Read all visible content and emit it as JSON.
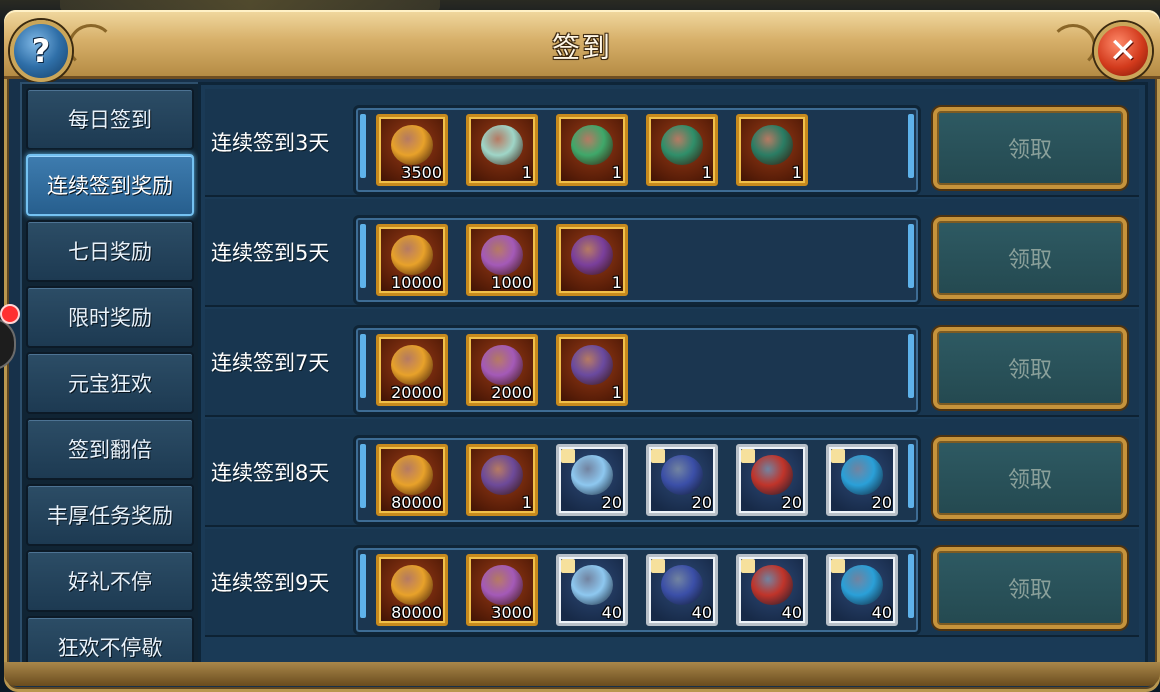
{
  "window": {
    "title": "签到",
    "help_label": "?",
    "close_label": "✕"
  },
  "sidebar": {
    "items": [
      {
        "label": "每日签到",
        "active": false
      },
      {
        "label": "连续签到奖励",
        "active": true
      },
      {
        "label": "七日奖励",
        "active": false
      },
      {
        "label": "限时奖励",
        "active": false
      },
      {
        "label": "元宝狂欢",
        "active": false
      },
      {
        "label": "签到翻倍",
        "active": false
      },
      {
        "label": "丰厚任务奖励",
        "active": false
      },
      {
        "label": "好礼不停",
        "active": false
      },
      {
        "label": "狂欢不停歇",
        "active": false
      }
    ]
  },
  "rows": [
    {
      "label": "连续签到3天",
      "claim_label": "领取",
      "items": [
        {
          "icon": "gold-ingot-icon",
          "qty": "3500",
          "frame": "gold",
          "color": "#e8a22a"
        },
        {
          "icon": "jade-pendant-icon",
          "qty": "1",
          "frame": "gold",
          "color": "#9fd6c8"
        },
        {
          "icon": "jade-bracelet-icon",
          "qty": "1",
          "frame": "gold",
          "color": "#3fa86a"
        },
        {
          "icon": "jade-armor-icon",
          "qty": "1",
          "frame": "gold",
          "color": "#2f8f6a"
        },
        {
          "icon": "jade-helmet-icon",
          "qty": "1",
          "frame": "gold",
          "color": "#2a7d64"
        }
      ]
    },
    {
      "label": "连续签到5天",
      "claim_label": "领取",
      "items": [
        {
          "icon": "gold-ingot-icon",
          "qty": "10000",
          "frame": "gold",
          "color": "#e8a22a"
        },
        {
          "icon": "purple-flower-icon",
          "qty": "1000",
          "frame": "gold",
          "color": "#a45ab8"
        },
        {
          "icon": "purple-helmet-icon",
          "qty": "1",
          "frame": "gold",
          "color": "#7a3f9c"
        }
      ]
    },
    {
      "label": "连续签到7天",
      "claim_label": "领取",
      "items": [
        {
          "icon": "gold-ingot-icon",
          "qty": "20000",
          "frame": "gold",
          "color": "#e8a22a"
        },
        {
          "icon": "purple-flower-icon",
          "qty": "2000",
          "frame": "gold",
          "color": "#a45ab8"
        },
        {
          "icon": "purple-mask-icon",
          "qty": "1",
          "frame": "gold",
          "color": "#6a4aa0"
        }
      ]
    },
    {
      "label": "连续签到8天",
      "claim_label": "领取",
      "items": [
        {
          "icon": "gold-ingot-icon",
          "qty": "80000",
          "frame": "gold",
          "color": "#e8a22a"
        },
        {
          "icon": "purple-boot-icon",
          "qty": "1",
          "frame": "gold",
          "color": "#6d4a9a"
        },
        {
          "icon": "ice-shard-fragment-icon",
          "qty": "20",
          "frame": "silver",
          "color": "#8ec8f0"
        },
        {
          "icon": "lightning-fragment-icon",
          "qty": "20",
          "frame": "silver",
          "color": "#3b4fa8"
        },
        {
          "icon": "red-robe-fragment-icon",
          "qty": "20",
          "frame": "silver",
          "color": "#c0342a"
        },
        {
          "icon": "blue-flame-fragment-icon",
          "qty": "20",
          "frame": "silver",
          "color": "#2aa0d8"
        }
      ]
    },
    {
      "label": "连续签到9天",
      "claim_label": "领取",
      "items": [
        {
          "icon": "gold-ingot-icon",
          "qty": "80000",
          "frame": "gold",
          "color": "#e8a22a"
        },
        {
          "icon": "purple-flower-icon",
          "qty": "3000",
          "frame": "gold",
          "color": "#a45ab8"
        },
        {
          "icon": "ice-shard-fragment-icon",
          "qty": "40",
          "frame": "silver",
          "color": "#8ec8f0"
        },
        {
          "icon": "lightning-fragment-icon",
          "qty": "40",
          "frame": "silver",
          "color": "#3b4fa8"
        },
        {
          "icon": "red-robe-fragment-icon",
          "qty": "40",
          "frame": "silver",
          "color": "#c0342a"
        },
        {
          "icon": "blue-flame-fragment-icon",
          "qty": "40",
          "frame": "silver",
          "color": "#2aa0d8"
        }
      ]
    }
  ]
}
